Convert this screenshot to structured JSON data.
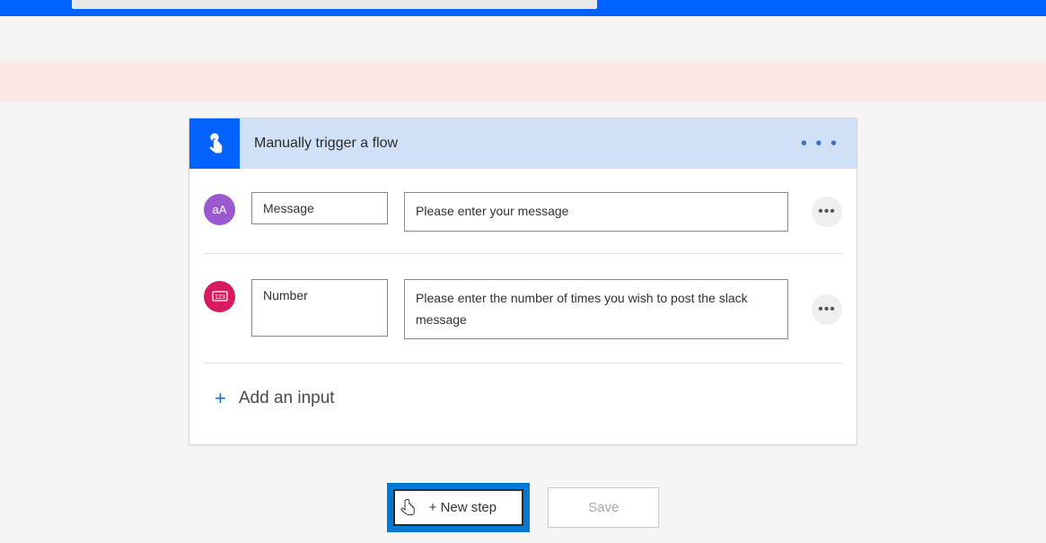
{
  "topbar": {
    "search_placeholder": ""
  },
  "trigger": {
    "title": "Manually trigger a flow",
    "inputs": [
      {
        "type": "text",
        "name": "Message",
        "description": "Please enter your message"
      },
      {
        "type": "number",
        "name": "Number",
        "description": "Please enter the number of times you wish to post the slack message"
      }
    ],
    "add_input_label": "Add an input"
  },
  "footer": {
    "new_step_label": "+ New step",
    "save_label": "Save"
  }
}
